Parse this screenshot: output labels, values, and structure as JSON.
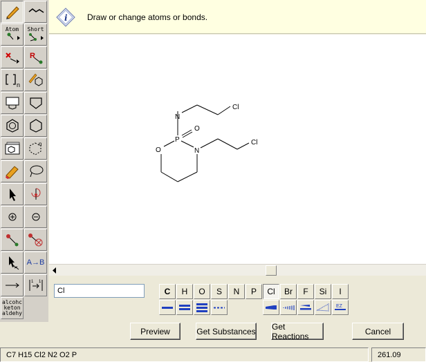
{
  "hint": {
    "text": "Draw or change atoms or bonds.",
    "icon": "info-icon"
  },
  "toolbar": {
    "atom_label": "Atom",
    "short_label": "Short",
    "r_label": "R",
    "bracket_sub": "n",
    "ab_label": "A→B",
    "alcohol_lines": [
      "alcohc",
      "keton",
      "aldehy"
    ]
  },
  "molecule": {
    "atoms": {
      "N1": "N",
      "Cl1": "Cl",
      "P": "P",
      "O_dbl": "O",
      "O_ring": "O",
      "N2": "N",
      "Cl2": "Cl"
    }
  },
  "element_input": {
    "value": "Cl"
  },
  "elements": [
    "C",
    "H",
    "O",
    "S",
    "N",
    "P",
    "Cl",
    "Br",
    "F",
    "Si",
    "I"
  ],
  "selected_element": "Cl",
  "buttons": {
    "preview": "Preview",
    "get_substances": "Get Substances",
    "get_reactions": "Get Reactions",
    "cancel": "Cancel"
  },
  "status": {
    "formula": "C7 H15 Cl2 N2 O2 P",
    "mass": "261.09"
  }
}
